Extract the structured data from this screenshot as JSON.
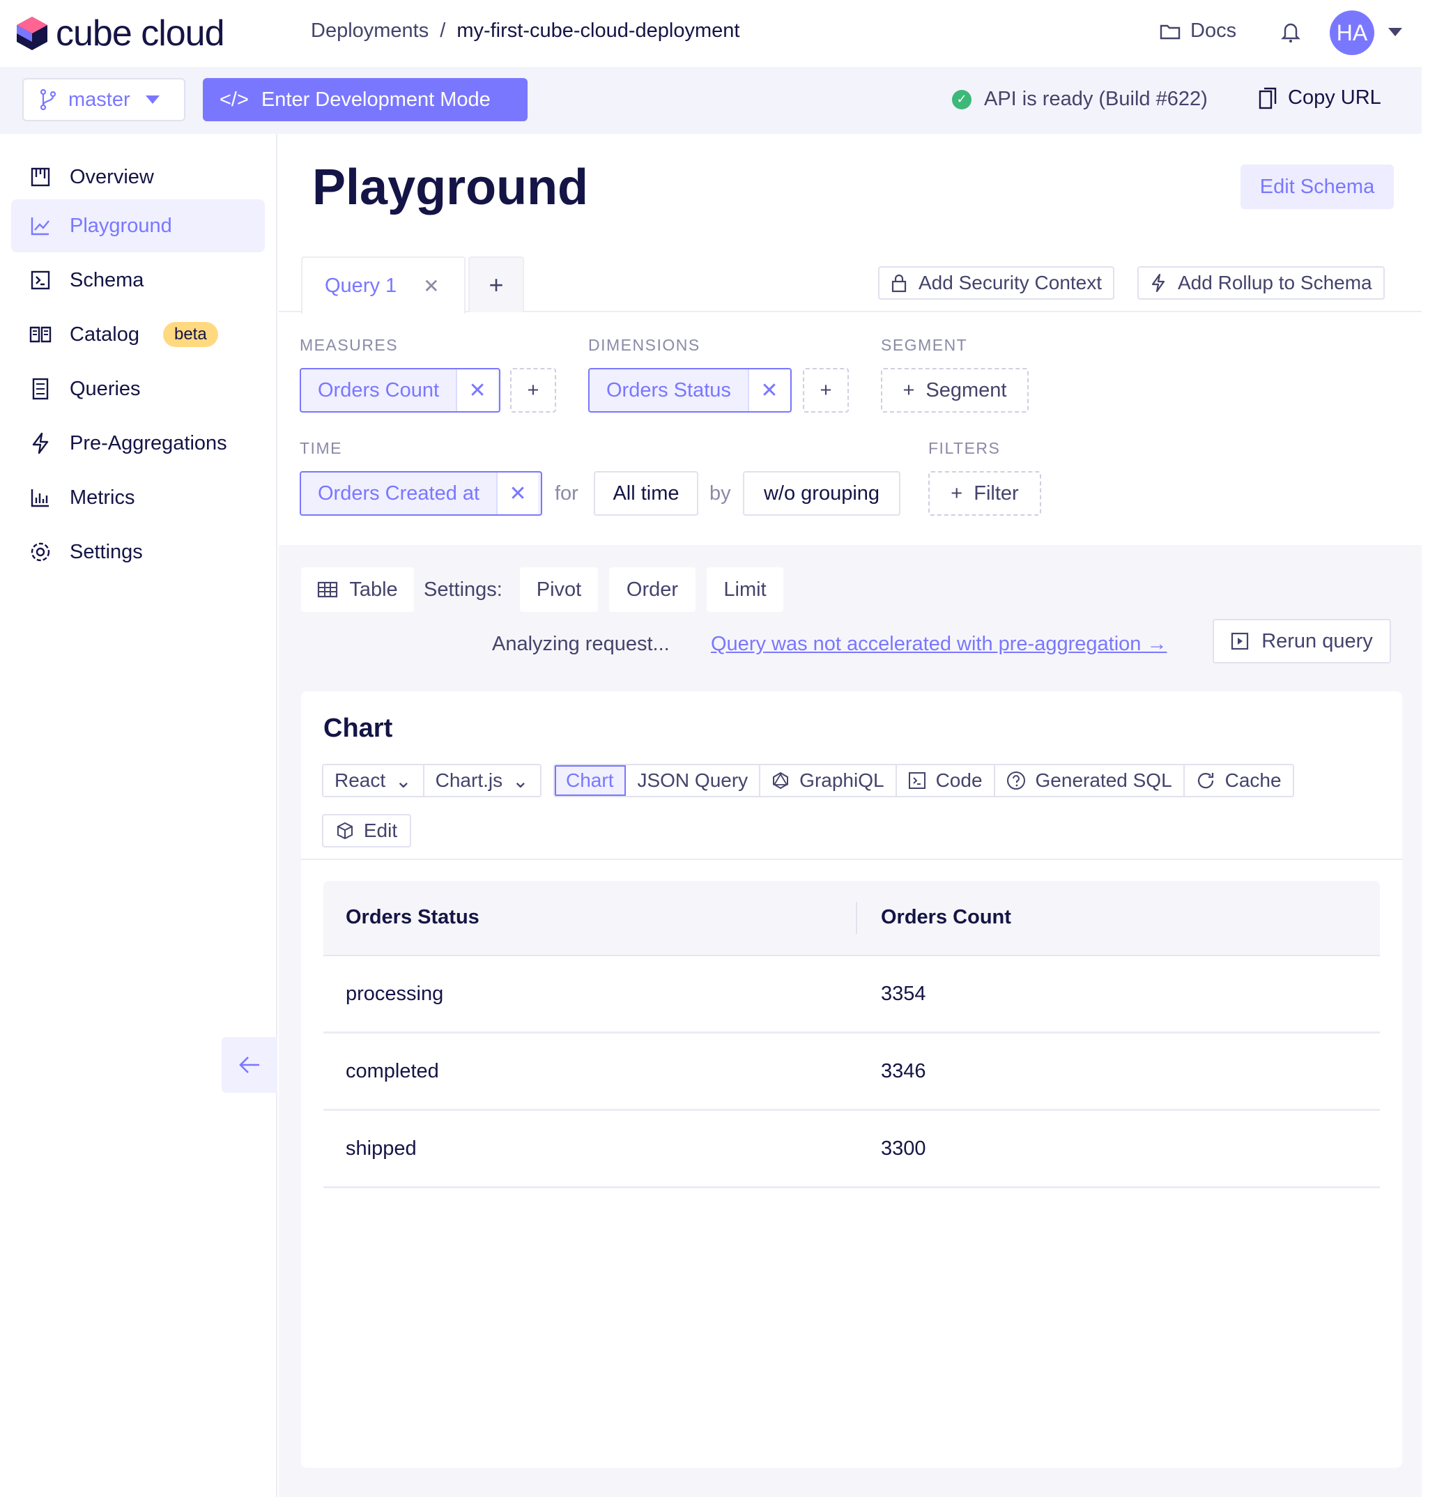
{
  "app": {
    "logo_text": "cube cloud",
    "breadcrumb": {
      "root": "Deployments",
      "separator": "/",
      "current": "my-first-cube-cloud-deployment"
    },
    "docs_label": "Docs",
    "avatar_initials": "HA"
  },
  "subbar": {
    "branch": "master",
    "dev_mode_label": "Enter Development Mode",
    "dev_mode_icon": "</>",
    "api_status": "API is ready (Build #622)",
    "copy_url_label": "Copy URL"
  },
  "sidebar": {
    "items": [
      {
        "label": "Overview",
        "icon": "overview-icon"
      },
      {
        "label": "Playground",
        "icon": "chart-line-icon",
        "active": true
      },
      {
        "label": "Schema",
        "icon": "terminal-icon"
      },
      {
        "label": "Catalog",
        "icon": "book-icon",
        "badge": "beta"
      },
      {
        "label": "Queries",
        "icon": "list-icon"
      },
      {
        "label": "Pre-Aggregations",
        "icon": "lightning-icon"
      },
      {
        "label": "Metrics",
        "icon": "bar-chart-icon"
      },
      {
        "label": "Settings",
        "icon": "gear-icon"
      }
    ]
  },
  "main": {
    "title": "Playground",
    "edit_schema_label": "Edit Schema",
    "query_tab_label": "Query 1",
    "add_security_context": "Add Security Context",
    "add_rollup": "Add Rollup to Schema",
    "builder": {
      "measures_label": "MEASURES",
      "measure_chip": "Orders Count",
      "dimensions_label": "DIMENSIONS",
      "dimension_chip": "Orders Status",
      "segment_label": "SEGMENT",
      "segment_btn": "Segment",
      "time_label": "TIME",
      "time_chip": "Orders Created at",
      "for_label": "for",
      "range": "All time",
      "by_label": "by",
      "granularity": "w/o grouping",
      "filters_label": "FILTERS",
      "filter_btn": "Filter"
    },
    "results": {
      "table_label": "Table",
      "settings_label": "Settings:",
      "pivot": "Pivot",
      "order": "Order",
      "limit": "Limit",
      "analyzing": "Analyzing request...",
      "not_accelerated": "Query was not accelerated with pre-aggregation →",
      "rerun": "Rerun query"
    },
    "chart_card": {
      "title": "Chart",
      "framework": "React",
      "library": "Chart.js",
      "tabs": [
        "Chart",
        "JSON Query",
        "GraphiQL",
        "Code",
        "Generated SQL",
        "Cache"
      ],
      "edit": "Edit"
    },
    "table": {
      "headers": [
        "Orders Status",
        "Orders Count"
      ],
      "rows": [
        [
          "processing",
          "3354"
        ],
        [
          "completed",
          "3346"
        ],
        [
          "shipped",
          "3300"
        ]
      ]
    }
  },
  "colors": {
    "accent": "#7a77ff",
    "text": "#141446",
    "success": "#3cb878",
    "beta": "#ffd980"
  }
}
